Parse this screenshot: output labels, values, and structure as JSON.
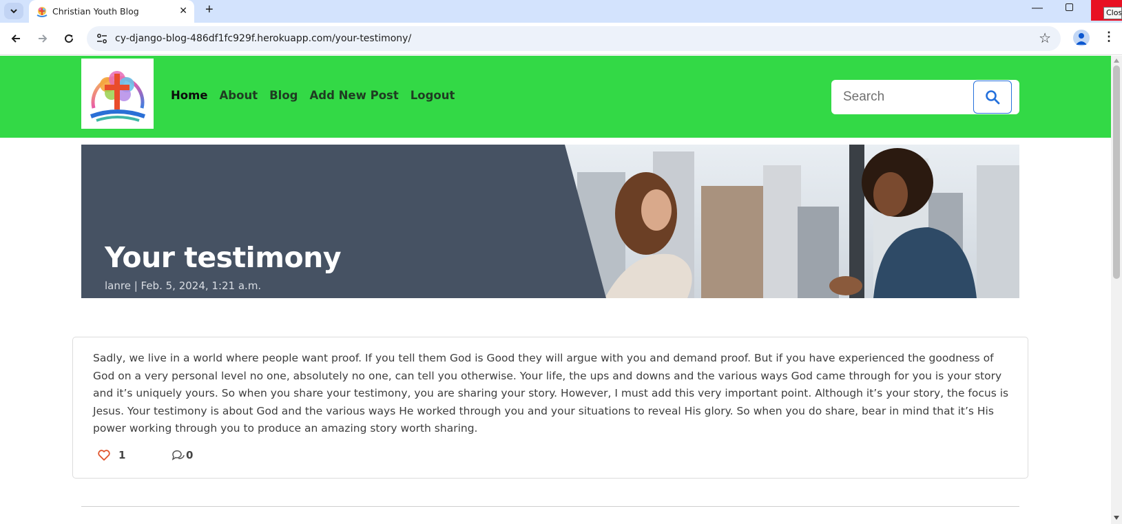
{
  "browser": {
    "tab_title": "Christian Youth Blog",
    "url": "cy-django-blog-486df1fc929f.herokuapp.com/your-testimony/",
    "tooltip": "Close"
  },
  "site": {
    "nav": {
      "items": [
        {
          "label": "Home"
        },
        {
          "label": "About"
        },
        {
          "label": "Blog"
        },
        {
          "label": "Add New Post"
        },
        {
          "label": "Logout"
        }
      ]
    },
    "search": {
      "placeholder": "Search"
    },
    "colors": {
      "navbar": "#33d946",
      "hero_panel": "#465263",
      "accent": "#e0532b"
    }
  },
  "post": {
    "title": "Your testimony",
    "meta": "lanre | Feb. 5, 2024, 1:21 a.m.",
    "body": "Sadly, we live in a world where people want proof. If you tell them God is Good they will argue with you and demand proof. But if you have experienced the goodness of God on a very personal level no one, absolutely no one, can tell you otherwise. Your life, the ups and downs and the various ways God came through for you is your story and it’s uniquely yours. So when you share your testimony, you are sharing your story. However, I must add this very important point. Although it’s your story, the focus is Jesus. Your testimony is about God and the various ways He worked through you and your situations to reveal His glory. So when you do share, bear in mind that it’s His power working through you to produce an amazing story worth sharing.",
    "likes": "1",
    "comments": "0"
  }
}
